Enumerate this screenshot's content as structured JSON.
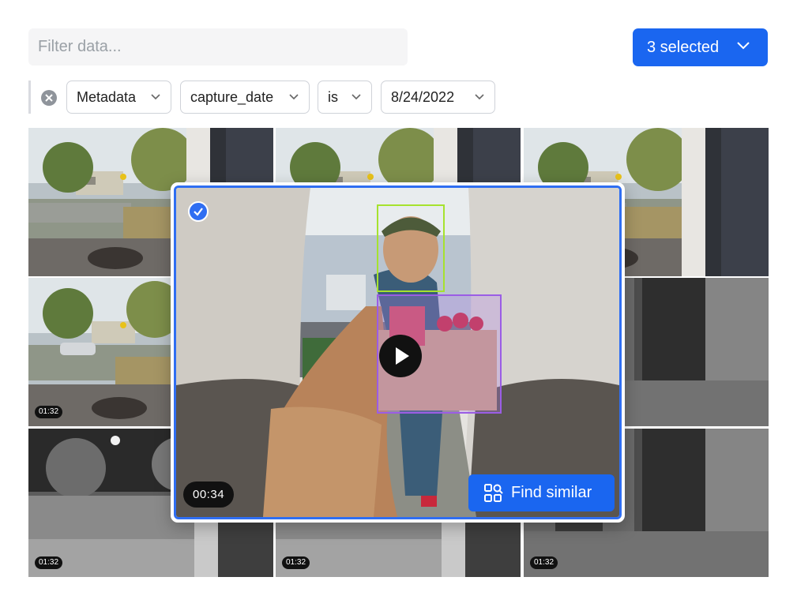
{
  "search": {
    "placeholder": "Filter data..."
  },
  "selection": {
    "label": "3 selected"
  },
  "filters": {
    "field": "Metadata",
    "key": "capture_date",
    "operator": "is",
    "value": "8/24/2022"
  },
  "tiles": [
    {
      "scene": "day",
      "duration": ""
    },
    {
      "scene": "day",
      "duration": ""
    },
    {
      "scene": "day",
      "duration": ""
    },
    {
      "scene": "day-car",
      "duration": "01:32"
    },
    {
      "scene": "night-door",
      "duration": ""
    },
    {
      "scene": "night-door",
      "duration": ""
    },
    {
      "scene": "night",
      "duration": "01:32"
    },
    {
      "scene": "night",
      "duration": "01:32"
    },
    {
      "scene": "night-door",
      "duration": "01:32"
    }
  ],
  "preview": {
    "duration": "00:34",
    "find_similar_label": "Find similar",
    "selected": true
  },
  "colors": {
    "accent": "#1a66f0",
    "face_box": "#a6e22e",
    "object_box": "#9b5de5"
  }
}
